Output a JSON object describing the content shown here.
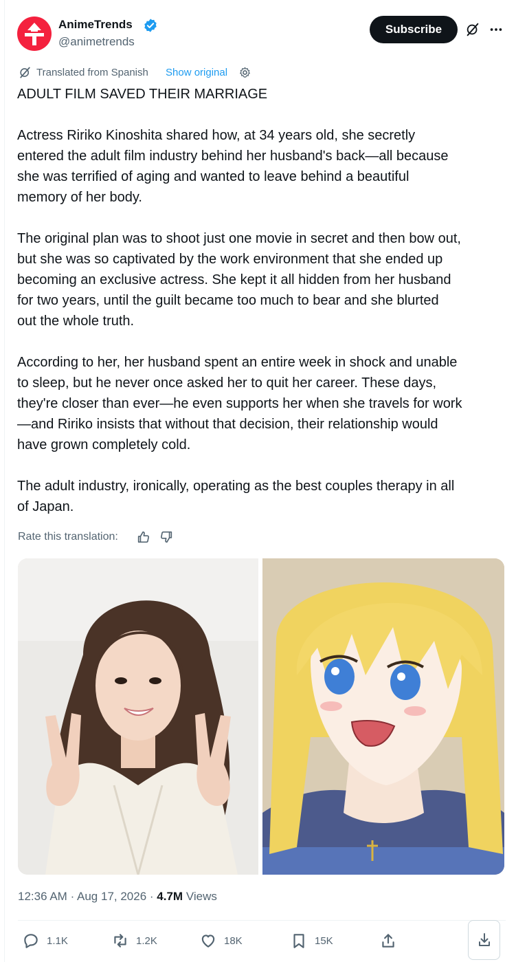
{
  "author": {
    "name": "AnimeTrends",
    "handle": "@animetrends",
    "verified": true,
    "avatar_color": "#f4213e"
  },
  "header": {
    "subscribe_label": "Subscribe",
    "icons": [
      "grok-icon",
      "more-icon"
    ]
  },
  "translation": {
    "label": "Translated from Spanish",
    "show_original": "Show original"
  },
  "tweet": {
    "headline": "ADULT FILM SAVED THEIR MARRIAGE",
    "paragraphs": [
      "Actress Ririko Kinoshita shared how, at 34 years old, she secretly\nentered the adult film industry behind her husband's back—all because\nshe was terrified of aging and wanted to leave behind a beautiful\nmemory of her body.",
      "The original plan was to shoot just one movie in secret and then bow out,\nbut she was so captivated by the work environment that she ended up\nbecoming an exclusive actress. She kept it all hidden from her husband\nfor two years, until the guilt became too much to bear and she blurted\nout the whole truth.",
      "According to her, her husband spent an entire week in shock and unable\nto sleep, but he never once asked her to quit her career. These days,\nthey're closer than ever—he even supports her when she travels for work\n—and Ririko insists that without that decision, their relationship would\nhave grown completely cold.",
      "The adult industry, ironically, operating as the best couples therapy in all\nof Japan."
    ]
  },
  "rate": {
    "label": "Rate this translation:"
  },
  "meta": {
    "time": "12:36 AM",
    "date": "Aug 17, 2026",
    "views_count": "4.7M",
    "views_label": "Views"
  },
  "actions": {
    "replies": "1.1K",
    "reposts": "1.2K",
    "likes": "18K",
    "bookmarks": "15K"
  },
  "colors": {
    "link": "#1d9bf0",
    "muted": "#536471",
    "text": "#0f1419"
  }
}
